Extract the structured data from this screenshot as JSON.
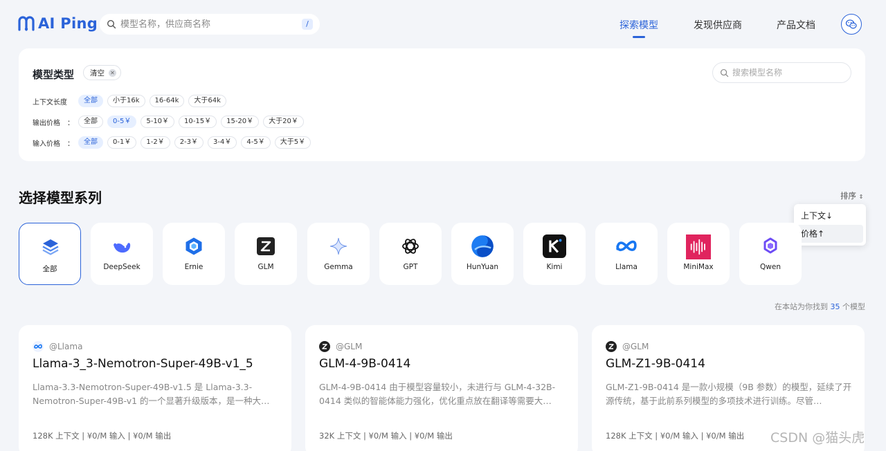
{
  "header": {
    "logo_text": "AI Ping",
    "search_placeholder": "模型名称，供应商名称",
    "search_shortcut": "/",
    "nav": [
      "探索模型",
      "发现供应商",
      "产品文档"
    ]
  },
  "filters": {
    "title": "模型类型",
    "clear_label": "清空",
    "search_placeholder": "搜索模型名称",
    "rows": [
      {
        "label": "上下文长度",
        "options": [
          "全部",
          "小于16k",
          "16-64k",
          "大于64k"
        ],
        "selected": 0
      },
      {
        "label": "输出价格　：",
        "options": [
          "全部",
          "0-5￥",
          "5-10￥",
          "10-15￥",
          "15-20￥",
          "大于20￥"
        ],
        "selected": 1
      },
      {
        "label": "输入价格　：",
        "options": [
          "全部",
          "0-1￥",
          "1-2￥",
          "2-3￥",
          "3-4￥",
          "4-5￥",
          "大于5￥"
        ],
        "selected": 0
      }
    ]
  },
  "section": {
    "title": "选择模型系列",
    "sort_label": "排序",
    "sort_options": [
      "上下文↓",
      "价格↑"
    ],
    "sort_highlighted": 1
  },
  "series": [
    {
      "name": "全部",
      "icon": "layers-icon"
    },
    {
      "name": "DeepSeek",
      "icon": "deepseek-whale-icon"
    },
    {
      "name": "Ernie",
      "icon": "ernie-hex-icon"
    },
    {
      "name": "GLM",
      "icon": "glm-z-icon"
    },
    {
      "name": "Gemma",
      "icon": "gemma-star-icon"
    },
    {
      "name": "GPT",
      "icon": "openai-knot-icon"
    },
    {
      "name": "HunYuan",
      "icon": "hunyuan-circle-icon"
    },
    {
      "name": "Kimi",
      "icon": "kimi-k-icon"
    },
    {
      "name": "Llama",
      "icon": "meta-infinity-icon"
    },
    {
      "name": "MiniMax",
      "icon": "minimax-wave-icon"
    },
    {
      "name": "Qwen",
      "icon": "qwen-star-icon"
    }
  ],
  "results": {
    "prefix": "在本站为你找到",
    "count": "35",
    "suffix": "个模型"
  },
  "models": [
    {
      "provider": "@Llama",
      "provider_icon": "meta-infinity-icon",
      "name": "Llama-3_3-Nemotron-Super-49B-v1_5",
      "description": "Llama-3.3-Nemotron-Super-49B-v1.5 是 Llama-3.3-Nemotron-Super-49B-v1 的一个显著升级版本，是一种大…",
      "meta": "128K 上下文 | ¥0/M 输入 | ¥0/M 输出"
    },
    {
      "provider": "@GLM",
      "provider_icon": "glm-z-icon",
      "name": "GLM-4-9B-0414",
      "description": "GLM-4-9B-0414 由于模型容量较小，未进行与 GLM-4-32B-0414 类似的智能体能力强化，优化重点放在翻译等需要大…",
      "meta": "32K 上下文 | ¥0/M 输入 | ¥0/M 输出"
    },
    {
      "provider": "@GLM",
      "provider_icon": "glm-z-icon",
      "name": "GLM-Z1-9B-0414",
      "description": "GLM-Z1-9B-0414 是一款小规模（9B 参数）的模型，延续了开源传统，基于此前系列模型的多项技术进行训练。尽管…",
      "meta": "128K 上下文 | ¥0/M 输入 | ¥0/M 输出"
    }
  ],
  "watermark": "CSDN @猫头虎"
}
